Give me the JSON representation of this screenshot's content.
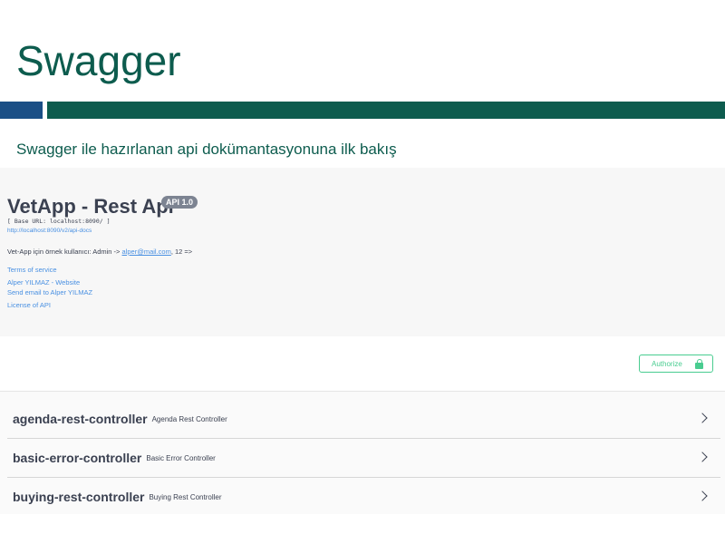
{
  "slide": {
    "title": "Swagger",
    "subtitle": "Swagger ile hazırlanan api dokümantasyonuna ilk bakış"
  },
  "api": {
    "title": "VetApp - Rest Api",
    "version": "API 1.0",
    "base_url": "[ Base URL: localhost:8090/ ]",
    "docs_url": "http://localhost:8090/v2/api-docs",
    "description_prefix": "Vet-App için örnek kullanıcı: Admin -> ",
    "description_email": "alper@mail.com",
    "description_suffix": ", 12 =>",
    "terms": "Terms of service",
    "website": "Alper YILMAZ - Website",
    "email_link": "Send email to Alper YILMAZ",
    "license": "License of API"
  },
  "authorize": {
    "label": "Authorize",
    "icon": "lock-icon",
    "color": "#49cc90"
  },
  "controllers": [
    {
      "name": "agenda-rest-controller",
      "description": "Agenda Rest Controller"
    },
    {
      "name": "basic-error-controller",
      "description": "Basic Error Controller"
    },
    {
      "name": "buying-rest-controller",
      "description": "Buying Rest Controller"
    }
  ],
  "colors": {
    "brand_green": "#0d5c4e",
    "brand_blue": "#1b4f86",
    "link": "#4990e2",
    "text": "#3b4151"
  }
}
